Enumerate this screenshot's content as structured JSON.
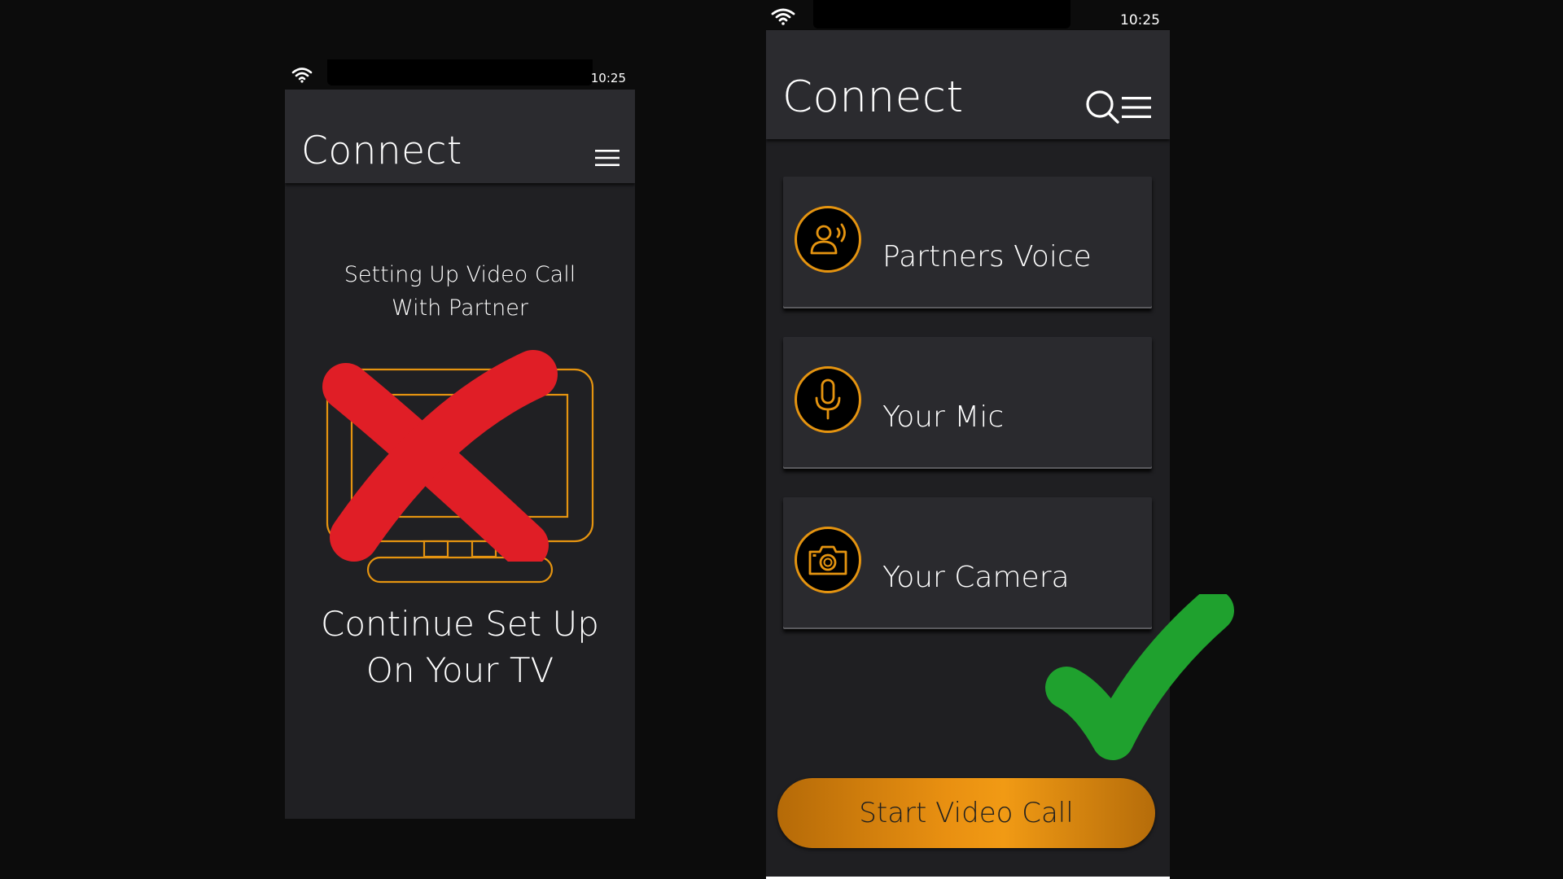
{
  "left_screen": {
    "status_time": "10:25",
    "title": "Connect",
    "setup_line1": "Setting Up Video Call",
    "setup_line2": "With Partner",
    "continue_line1": "Continue Set Up",
    "continue_line2": "On Your TV",
    "icons": [
      "wifi-icon",
      "menu-icon",
      "tv-icon",
      "red-x-mark"
    ]
  },
  "right_screen": {
    "status_time": "10:25",
    "title": "Connect",
    "cards": [
      {
        "label": "Partners Voice",
        "icon": "partner-voice-icon"
      },
      {
        "label": "Your Mic",
        "icon": "mic-icon"
      },
      {
        "label": "Your Camera",
        "icon": "camera-icon"
      }
    ],
    "start_button": "Start Video Call",
    "icons": [
      "wifi-icon",
      "search-icon",
      "menu-icon",
      "green-check-mark"
    ]
  },
  "colors": {
    "accent_orange": "#e59410",
    "cross_red": "#e01e26",
    "check_green": "#1fa12e",
    "appbar_bg": "#2b2b2f",
    "screen_bg": "#202023"
  }
}
